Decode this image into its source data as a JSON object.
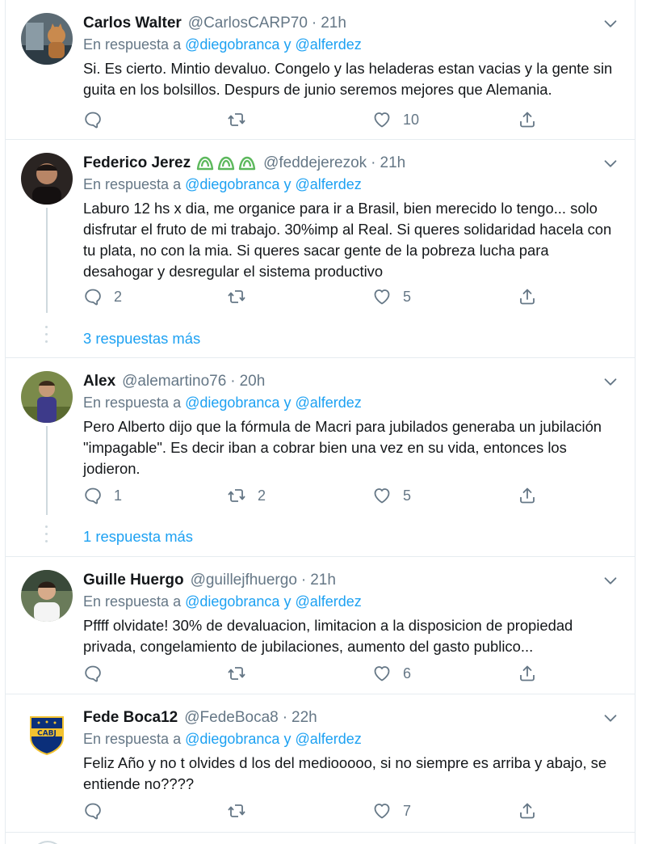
{
  "tweets": [
    {
      "name": "Carlos Walter",
      "handle": "@CarlosCARP70",
      "sep": "·",
      "time": "21h",
      "reply_prefix": "En respuesta a",
      "mention1": "@diegobranca",
      "conj": "y",
      "mention2": "@alferdez",
      "text": "Si. Es cierto. Mintio devaluo. Congelo y las heladeras estan vacias y la gente sin guita en los bolsillos. Despurs de junio seremos mejores que Alemania.",
      "replies": "",
      "retweets": "",
      "likes": "10"
    },
    {
      "name": "Federico Jerez",
      "handle": "@feddejerezok",
      "sep": "·",
      "time": "21h",
      "reply_prefix": "En respuesta a",
      "mention1": "@diegobranca",
      "conj": "y",
      "mention2": "@alferdez",
      "text": "Laburo 12 hs x dia, me organice para ir a Brasil, bien merecido lo tengo... solo disfrutar el fruto de mi trabajo. 30%imp al Real. Si queres solidaridad hacela con tu plata, no con la mia. Si queres sacar gente de la pobreza lucha para desahogar y desregular el sistema productivo",
      "replies": "2",
      "retweets": "",
      "likes": "5",
      "more": "3 respuestas más"
    },
    {
      "name": "Alex",
      "handle": "@alemartino76",
      "sep": "·",
      "time": "20h",
      "reply_prefix": "En respuesta a",
      "mention1": "@diegobranca",
      "conj": "y",
      "mention2": "@alferdez",
      "text": "Pero Alberto dijo que la fórmula de Macri para jubilados generaba un jubilación \"impagable\". Es decir iban a cobrar bien una vez en su vida, entonces los jodieron.",
      "replies": "1",
      "retweets": "2",
      "likes": "5",
      "more": "1 respuesta más"
    },
    {
      "name": "Guille Huergo",
      "handle": "@guillejfhuergo",
      "sep": "·",
      "time": "21h",
      "reply_prefix": "En respuesta a",
      "mention1": "@diegobranca",
      "conj": "y",
      "mention2": "@alferdez",
      "text": "Pffff olvidate! 30% de devaluacion, limitacion a la disposicion de propiedad privada, congelamiento de jubilaciones, aumento del gasto publico...",
      "replies": "",
      "retweets": "",
      "likes": "6"
    },
    {
      "name": "Fede Boca12",
      "handle": "@FedeBoca8",
      "sep": "·",
      "time": "22h",
      "reply_prefix": "En respuesta a",
      "mention1": "@diegobranca",
      "conj": "y",
      "mention2": "@alferdez",
      "text": "Feliz Año y no t olvides d los del mediooooo, si no siempre es arriba y abajo, se entiende no????",
      "replies": "",
      "retweets": "",
      "likes": "7",
      "badge_text": "CABJ"
    }
  ],
  "colors": {
    "link": "#1da1f2",
    "muted": "#657786",
    "text": "#14171a",
    "border": "#e6ecf0",
    "emoji_green": "#5cb85c"
  },
  "icons": {
    "reply": "reply-icon",
    "retweet": "retweet-icon",
    "like": "heart-icon",
    "share": "share-icon",
    "caret": "chevron-down-icon",
    "name_emoji": "green-emoji-icon"
  }
}
